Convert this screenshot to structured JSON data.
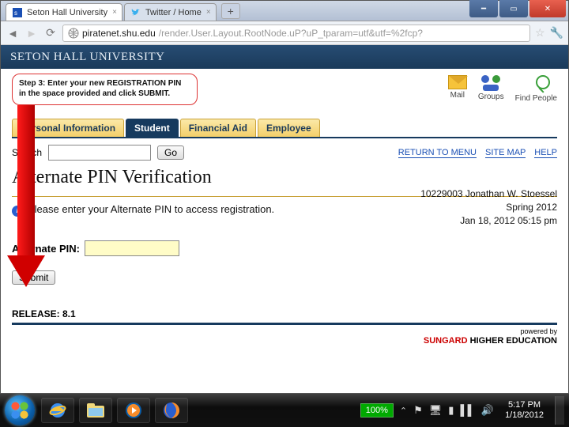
{
  "browser": {
    "tabs": [
      {
        "title": "Seton Hall University"
      },
      {
        "title": "Twitter / Home"
      }
    ],
    "url_host": "piratenet.shu.edu",
    "url_path": "/render.User.Layout.RootNode.uP?uP_tparam=utf&utf=%2fcp?"
  },
  "banner": {
    "text": "SETON HALL UNIVERSITY"
  },
  "callout": {
    "text": "Step 3: Enter your new REGISTRATION PIN in the space provided and click SUBMIT."
  },
  "top_icons": {
    "mail": "Mail",
    "groups": "Groups",
    "find": "Find People"
  },
  "nav_tabs": [
    "Personal Information",
    "Student",
    "Financial Aid",
    "Employee"
  ],
  "search": {
    "label": "Search",
    "go": "Go"
  },
  "right_links": {
    "menu": "RETURN TO MENU",
    "sitemap": "SITE MAP",
    "help": "HELP"
  },
  "page_title": "Alternate PIN Verification",
  "user": {
    "id_name": "10229003 Jonathan W. Stoessel",
    "term": "Spring 2012",
    "timestamp": "Jan 18, 2012 05:15 pm"
  },
  "instruction": "Please enter your Alternate PIN to access registration.",
  "pin": {
    "label": "Alternate PIN:"
  },
  "submit": "Submit",
  "release": "RELEASE: 8.1",
  "powered": {
    "by": "powered by",
    "brand1": "SUNGARD",
    "brand2": " HIGHER EDUCATION"
  },
  "taskbar": {
    "zoom": "100%",
    "time": "5:17 PM",
    "date": "1/18/2012"
  }
}
